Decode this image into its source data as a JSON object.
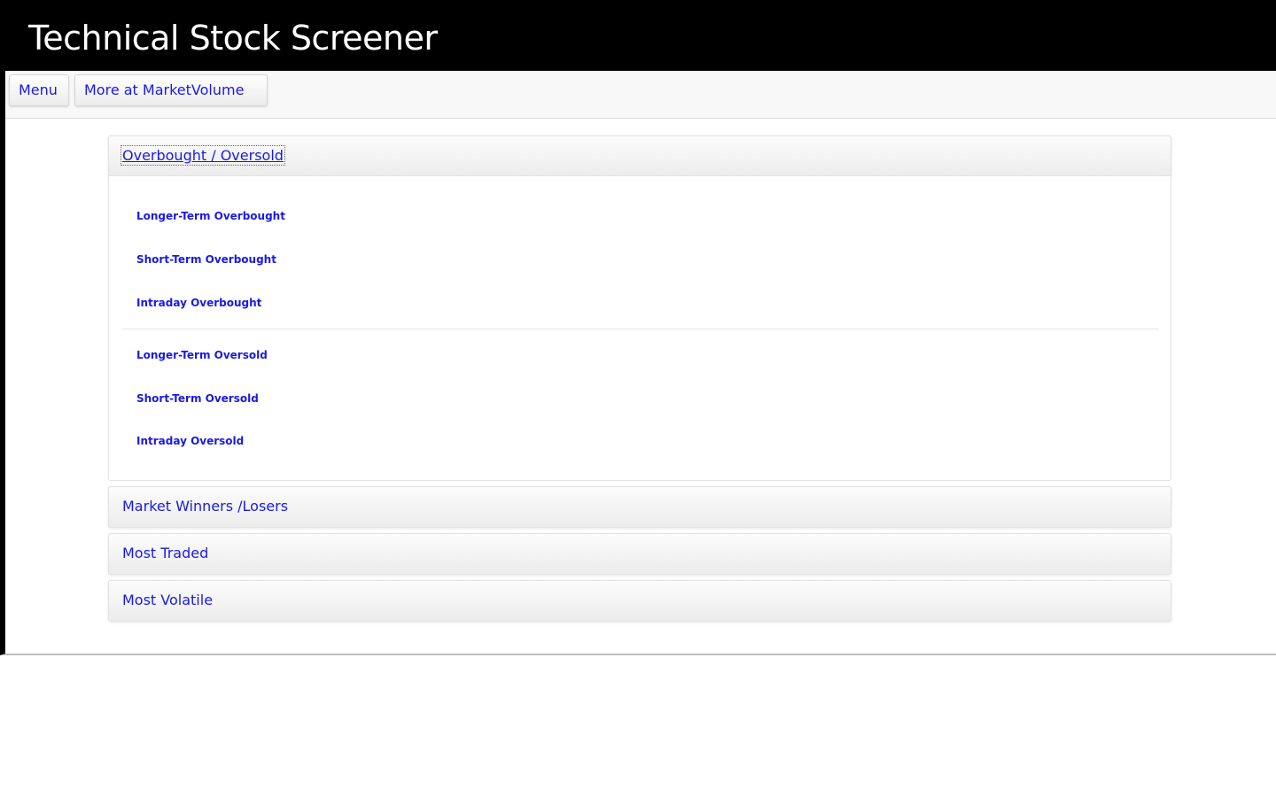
{
  "app": {
    "title": "Technical Stock Screener"
  },
  "toolbar": {
    "menu_label": "Menu",
    "more_label": "More at MarketVolume"
  },
  "accordion": {
    "open_section": {
      "label": "Overbought / Oversold",
      "overbought_items": [
        "Longer-Term Overbought",
        "Short-Term Overbought",
        "Intraday Overbought"
      ],
      "oversold_items": [
        "Longer-Term Oversold",
        "Short-Term Oversold",
        "Intraday Oversold"
      ]
    },
    "closed_sections": [
      "Market Winners /Losers",
      "Most Traded",
      "Most Volatile"
    ]
  },
  "colors": {
    "link": "#1a1ae6",
    "title_bar": "#000000"
  }
}
